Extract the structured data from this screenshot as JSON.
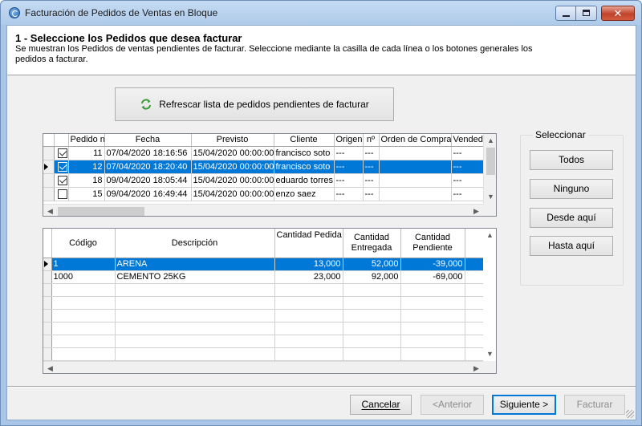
{
  "window": {
    "title": "Facturación de Pedidos de Ventas en Bloque",
    "close_glyph": "✕"
  },
  "header": {
    "title": "1 - Seleccione los Pedidos que desea facturar",
    "description": "Se muestran los Pedidos de ventas pendientes de facturar. Seleccione mediante la casilla de cada línea o los botones generales los pedidos a facturar."
  },
  "refresh_button": {
    "label": "Refrescar lista de pedidos pendientes de facturar",
    "icon": "refresh-icon"
  },
  "orders_grid": {
    "columns": [
      "Pedido nº",
      "Fecha",
      "Previsto",
      "Cliente",
      "Origen",
      "nº",
      "Orden de Compra",
      "Vendedor E"
    ],
    "rows": [
      {
        "checked": true,
        "selected": false,
        "pedido": "11",
        "fecha": "07/04/2020 18:16:56",
        "previsto": "15/04/2020 00:00:00",
        "cliente": "francisco soto",
        "origen": "---",
        "n": "---",
        "orden": "",
        "vendedor": "---",
        "extra": "-"
      },
      {
        "checked": true,
        "selected": true,
        "pedido": "12",
        "fecha": "07/04/2020 18:20:40",
        "previsto": "15/04/2020 00:00:00",
        "cliente": "francisco soto",
        "origen": "---",
        "n": "---",
        "orden": "",
        "vendedor": "---",
        "extra": "-"
      },
      {
        "checked": true,
        "selected": false,
        "pedido": "18",
        "fecha": "09/04/2020 18:05:44",
        "previsto": "15/04/2020 00:00:00",
        "cliente": "eduardo torres",
        "origen": "---",
        "n": "---",
        "orden": "",
        "vendedor": "---",
        "extra": "-"
      },
      {
        "checked": false,
        "selected": false,
        "pedido": "15",
        "fecha": "09/04/2020 16:49:44",
        "previsto": "15/04/2020 00:00:00",
        "cliente": "enzo saez",
        "origen": "---",
        "n": "---",
        "orden": "",
        "vendedor": "---",
        "extra": "-"
      }
    ]
  },
  "lines_grid": {
    "columns": [
      "Código",
      "Descripción",
      "Cantidad Pedida",
      "Cantidad Entregada",
      "Cantidad Pendiente"
    ],
    "rows": [
      {
        "selected": true,
        "codigo": "1",
        "descripcion": "ARENA",
        "pedida": "13,000",
        "entregada": "52,000",
        "pendiente": "-39,000"
      },
      {
        "selected": false,
        "codigo": "1000",
        "descripcion": "CEMENTO 25KG",
        "pedida": "23,000",
        "entregada": "92,000",
        "pendiente": "-69,000"
      }
    ]
  },
  "select_group": {
    "title": "Seleccionar",
    "buttons": [
      "Todos",
      "Ninguno",
      "Desde aquí",
      "Hasta aquí"
    ]
  },
  "nav": {
    "cancel": "Cancelar",
    "back": "<Anterior",
    "next": "Siguiente >",
    "finish": "Facturar"
  },
  "scroll_glyphs": {
    "up": "▲",
    "down": "▼",
    "left": "◀",
    "right": "▶"
  },
  "colors": {
    "selection": "#0078d7",
    "titlebar": "#aecaea",
    "close": "#c0432b"
  }
}
